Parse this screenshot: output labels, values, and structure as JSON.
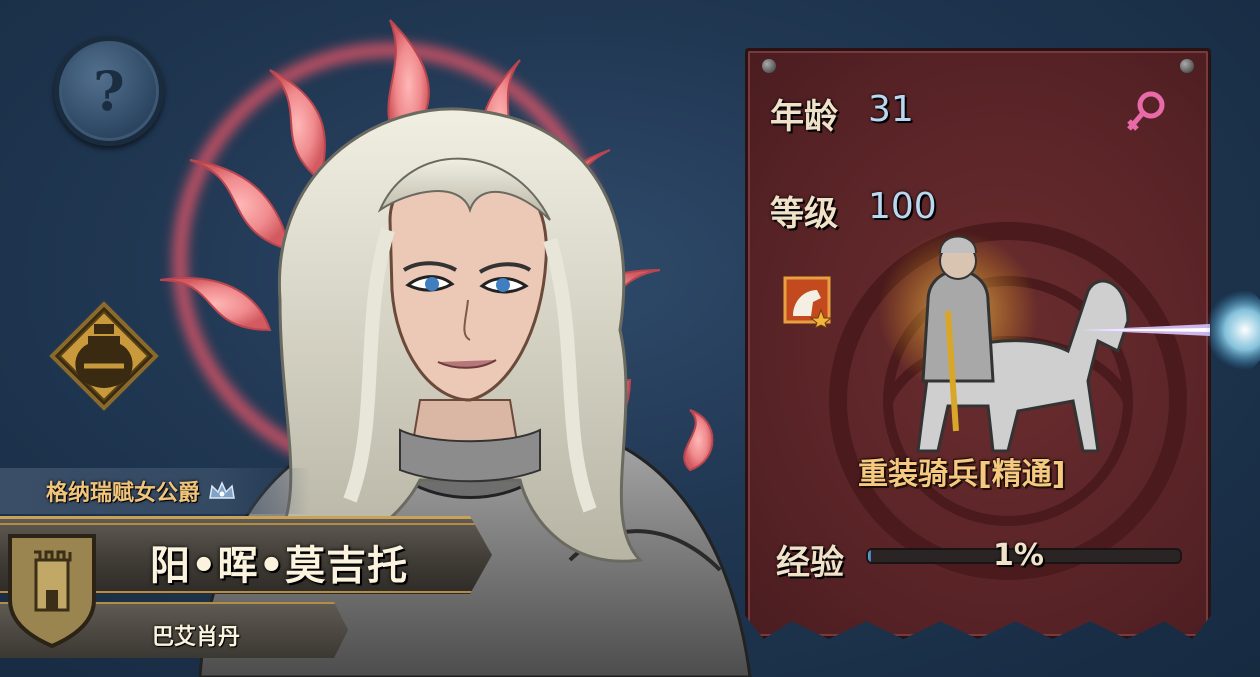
{
  "hero": {
    "title": "格纳瑞赋女公爵",
    "name": "阳•晖•莫吉托",
    "house": "巴艾肖丹"
  },
  "stats": {
    "age_label": "年龄",
    "age_value": "31",
    "level_label": "等级",
    "level_value": "100",
    "unit_name": "重装骑兵[精通]",
    "exp_label": "经验",
    "exp_value": "1%",
    "exp_fraction": 0.01
  },
  "colors": {
    "panel": "#5a2427",
    "accent_gold": "#f0c47a",
    "value_blue": "#b9d7f0",
    "gender_pink": "#e96aa8"
  },
  "icons": {
    "help": "question-icon",
    "gender": "female-icon",
    "unit": "cavalry-icon",
    "rank": "crown-icon",
    "house": "tower-shield-icon",
    "item": "potion-icon"
  }
}
